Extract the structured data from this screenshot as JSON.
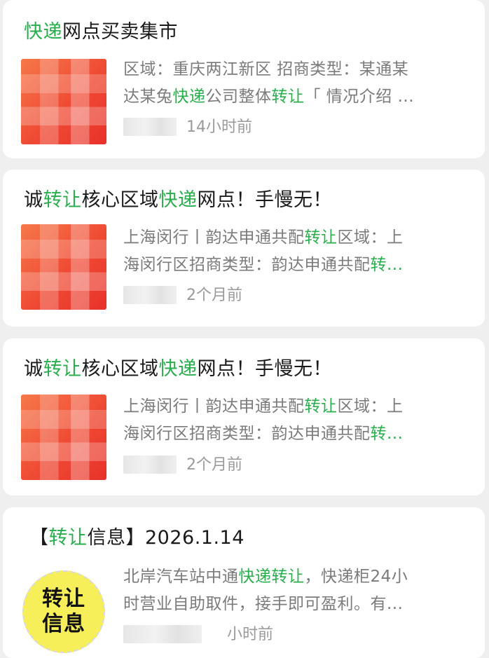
{
  "cards": [
    {
      "title": [
        [
          "快递",
          true
        ],
        [
          "网点买卖集市",
          false
        ]
      ],
      "desc_line1": [
        [
          "区域：重庆两江新区 招商类型：某通某",
          false
        ]
      ],
      "desc_line2": [
        [
          "达某兔",
          false
        ],
        [
          "快递",
          true
        ],
        [
          "公司整体",
          false
        ],
        [
          "转让",
          true
        ],
        [
          "「 情况介绍 ...",
          false
        ]
      ],
      "time": "14小时前"
    },
    {
      "title": [
        [
          "诚",
          false
        ],
        [
          "转让",
          true
        ],
        [
          "核心区域",
          false
        ],
        [
          "快递",
          true
        ],
        [
          "网点！手慢无！",
          false
        ]
      ],
      "desc_line1": [
        [
          "上海闵行丨韵达申通共配",
          false
        ],
        [
          "转让",
          true
        ],
        [
          "区域：上",
          false
        ]
      ],
      "desc_line2": [
        [
          "海闵行区招商类型：韵达申通共配",
          false
        ],
        [
          "转...",
          true
        ]
      ],
      "time": "2个月前"
    },
    {
      "title": [
        [
          "诚",
          false
        ],
        [
          "转让",
          true
        ],
        [
          "核心区域",
          false
        ],
        [
          "快递",
          true
        ],
        [
          "网点！手慢无！",
          false
        ]
      ],
      "desc_line1": [
        [
          "上海闵行丨韵达申通共配",
          false
        ],
        [
          "转让",
          true
        ],
        [
          "区域：上",
          false
        ]
      ],
      "desc_line2": [
        [
          "海闵行区招商类型：韵达申通共配",
          false
        ],
        [
          "转...",
          true
        ]
      ],
      "time": "2个月前"
    },
    {
      "title": [
        [
          "【",
          false
        ],
        [
          "转让",
          true
        ],
        [
          "信息】2026.1.14",
          false
        ]
      ],
      "desc_line1": [
        [
          "北岸汽车站中通",
          false
        ],
        [
          "快递",
          true
        ],
        [
          "转让",
          true
        ],
        [
          "，快递柜24小",
          false
        ]
      ],
      "desc_line2": [
        [
          "时营业自助取件，接手即可盈利。有...",
          false
        ]
      ],
      "time": "小时前",
      "badge": [
        "转让",
        "信息"
      ]
    }
  ],
  "colors": {
    "highlight": "#2aae4d",
    "meta": "#9a9a9a",
    "desc": "#7b7b7b"
  }
}
